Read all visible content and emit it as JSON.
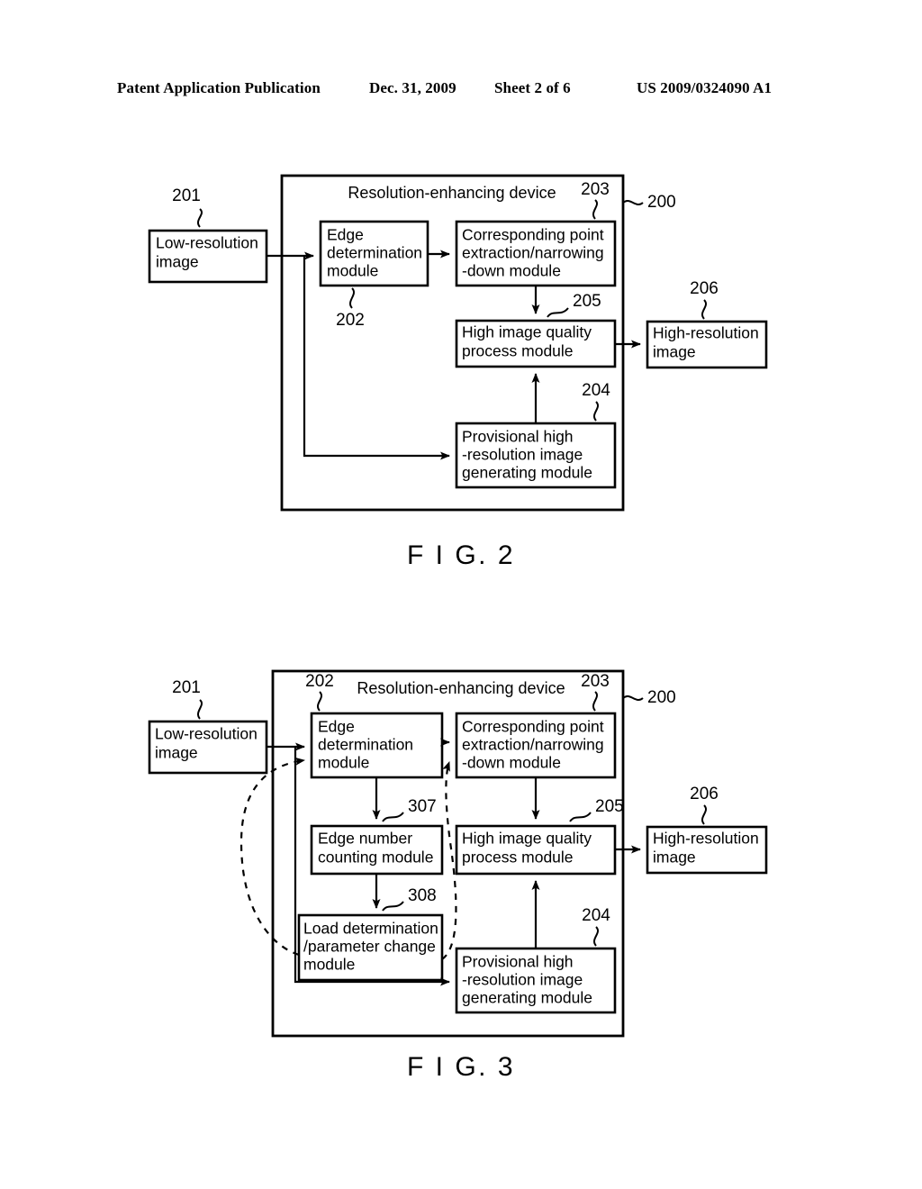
{
  "header": {
    "publication": "Patent Application Publication",
    "date": "Dec. 31, 2009",
    "sheet": "Sheet 2 of 6",
    "patent_number": "US 2009/0324090 A1"
  },
  "figure2": {
    "caption": "F I G. 2",
    "device_title": "Resolution-enhancing device",
    "device_ref": "200",
    "blocks": {
      "low_res": {
        "label": "Low-resolution\nimage",
        "ref": "201"
      },
      "edge_determination": {
        "label": "Edge\ndetermination\nmodule",
        "ref": "202"
      },
      "corresponding_point": {
        "label": "Corresponding point\nextraction/narrowing\n-down module",
        "ref": "203"
      },
      "high_quality": {
        "label": "High image quality\nprocess module",
        "ref": "205"
      },
      "provisional": {
        "label": "Provisional high\n-resolution image\ngenerating module",
        "ref": "204"
      },
      "high_res": {
        "label": "High-resolution\nimage",
        "ref": "206"
      }
    },
    "lines": {
      "low_res": [
        "Low-resolution",
        "image"
      ],
      "edge_determination": [
        "Edge",
        "determination",
        "module"
      ],
      "corresponding_point": [
        "Corresponding point",
        "extraction/narrowing",
        "-down module"
      ],
      "high_quality": [
        "High image quality",
        "process module"
      ],
      "provisional": [
        "Provisional high",
        "-resolution image",
        "generating module"
      ],
      "high_res": [
        "High-resolution",
        "image"
      ]
    }
  },
  "figure3": {
    "caption": "F I G. 3",
    "device_title": "Resolution-enhancing device",
    "device_ref": "200",
    "blocks": {
      "low_res": {
        "label": "Low-resolution\nimage",
        "ref": "201"
      },
      "edge_determination": {
        "label": "Edge\ndetermination\nmodule",
        "ref": "202"
      },
      "corresponding_point": {
        "label": "Corresponding point\nextraction/narrowing\n-down module",
        "ref": "203"
      },
      "edge_number": {
        "label": "Edge number\ncounting module",
        "ref": "307"
      },
      "load_determination": {
        "label": "Load determination\n/parameter change\nmodule",
        "ref": "308"
      },
      "high_quality": {
        "label": "High image quality\nprocess module",
        "ref": "205"
      },
      "provisional": {
        "label": "Provisional high\n-resolution image\ngenerating module",
        "ref": "204"
      },
      "high_res": {
        "label": "High-resolution\nimage",
        "ref": "206"
      }
    },
    "lines": {
      "low_res": [
        "Low-resolution",
        "image"
      ],
      "edge_determination": [
        "Edge",
        "determination",
        "module"
      ],
      "corresponding_point": [
        "Corresponding point",
        "extraction/narrowing",
        "-down module"
      ],
      "edge_number": [
        "Edge number",
        "counting module"
      ],
      "load_determination": [
        "Load determination",
        "/parameter change",
        "module"
      ],
      "high_quality": [
        "High image quality",
        "process module"
      ],
      "provisional": [
        "Provisional high",
        "-resolution image",
        "generating module"
      ],
      "high_res": [
        "High-resolution",
        "image"
      ]
    }
  },
  "colors": {
    "ink": "#000000",
    "paper": "#ffffff"
  }
}
